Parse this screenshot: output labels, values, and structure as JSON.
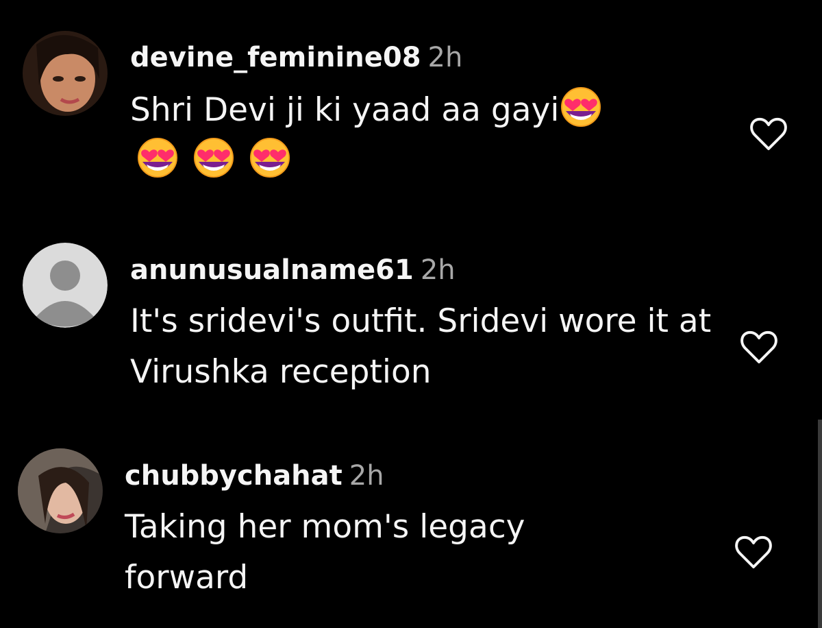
{
  "comments": [
    {
      "username": "devine_feminine08",
      "time": "2h",
      "text": "Shri Devi ji ki yaad aa gayi",
      "emoji_icon": "smiling-face-with-heart-eyes",
      "trailing_emoji_count": 1,
      "extra_emoji_count": 3
    },
    {
      "username": "anunusualname61",
      "time": "2h",
      "text": "It's sridevi's outfit. Sridevi wore it at Virushka reception"
    },
    {
      "username": "chubbychahat",
      "time": "2h",
      "text": "Taking her mom's legacy forward"
    }
  ],
  "like_icon": "heart-outline-icon",
  "colors": {
    "background": "#000000",
    "text": "#f5f5f5",
    "timestamp": "#a8a8a8",
    "icon": "#f5f5f5"
  }
}
